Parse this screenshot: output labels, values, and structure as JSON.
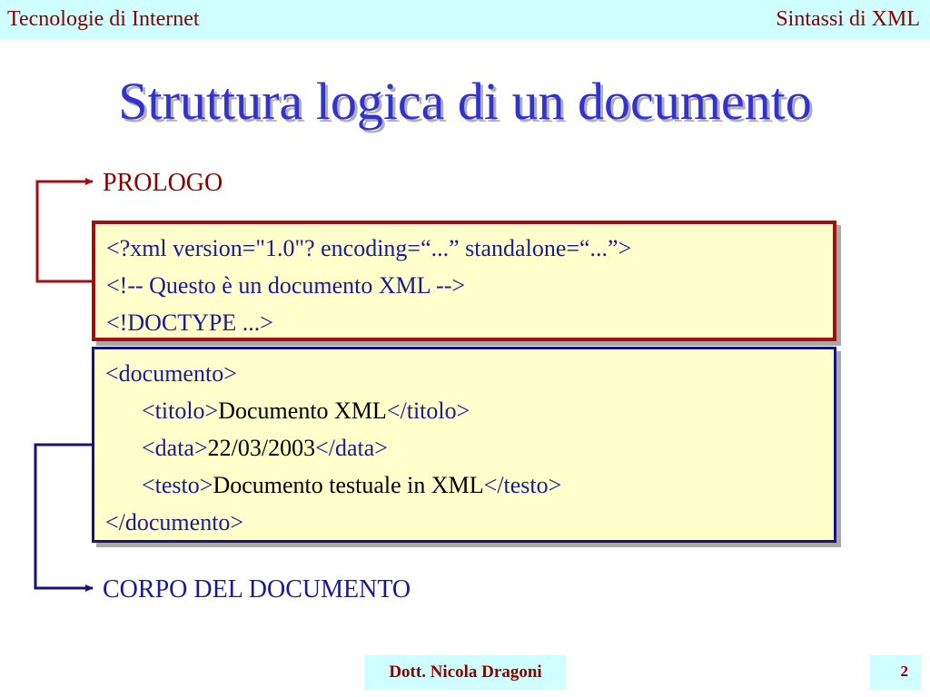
{
  "header": {
    "left": "Tecnologie di Internet",
    "right": "Sintassi di XML"
  },
  "title": "Struttura logica di un documento",
  "labels": {
    "prolog": "PROLOGO",
    "body": "CORPO DEL DOCUMENTO"
  },
  "prolog": {
    "lines": [
      "<?xml version=\"1.0\"? encoding=“...” standalone=“...”>",
      "<!-- Questo è un documento XML -->",
      "<!DOCTYPE ...>"
    ]
  },
  "body": {
    "root_open": "<documento>",
    "root_close": "</documento>",
    "elements": [
      {
        "open": "<titolo>",
        "text": "Documento XML",
        "close": "</titolo>"
      },
      {
        "open": "<data>",
        "text": "22/03/2003",
        "close": "</data>"
      },
      {
        "open": "<testo>",
        "text": "Documento testuale in XML",
        "close": "</testo>"
      }
    ]
  },
  "footer": {
    "author": "Dott. Nicola Dragoni",
    "page": "2"
  },
  "colors": {
    "header_bg": "#cfffff",
    "header_text": "#8b0000",
    "title": "#3333cc",
    "prolog_border": "#a01010",
    "body_border": "#14147a",
    "box_bg": "#ffffcc"
  }
}
